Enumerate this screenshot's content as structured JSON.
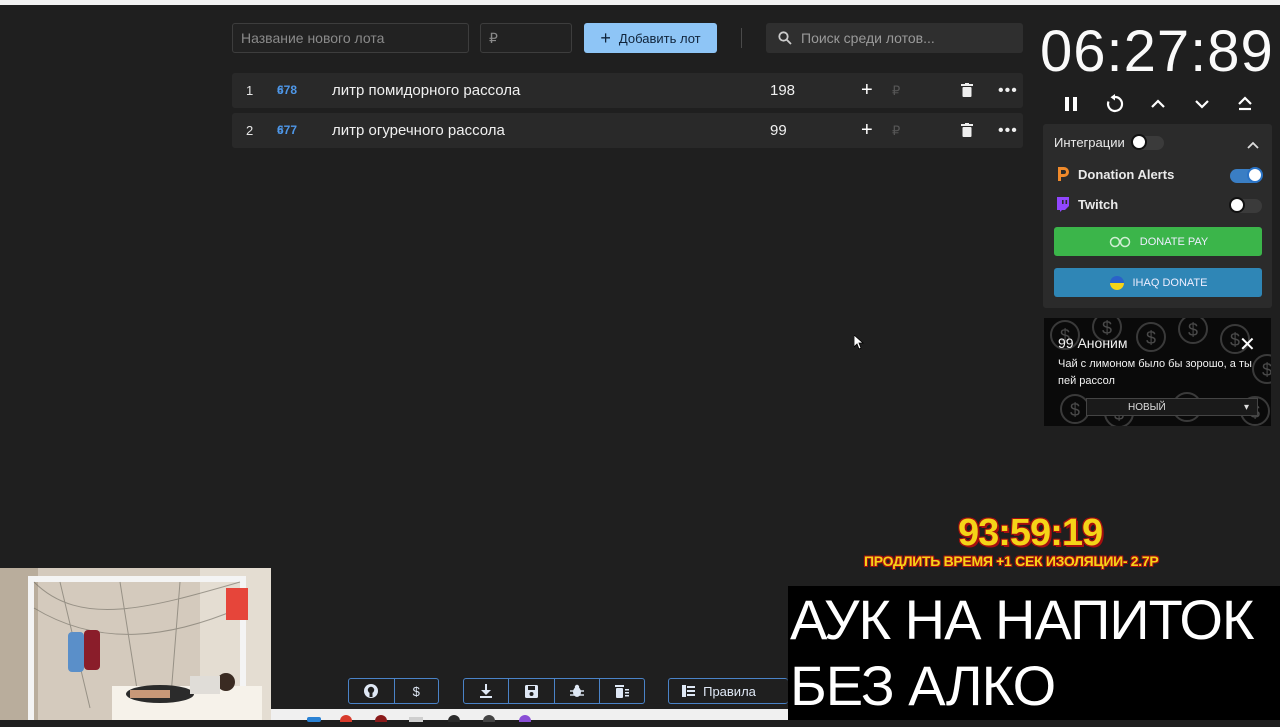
{
  "header": {
    "new_lot_placeholder": "Название нового лота",
    "amount_placeholder": "₽",
    "add_lot_label": "Добавить лот",
    "search_placeholder": "Поиск среди лотов..."
  },
  "lots": [
    {
      "num": "1",
      "id": "678",
      "name": "литр помидорного рассола",
      "amount": "198"
    },
    {
      "num": "2",
      "id": "677",
      "name": "литр огуречного рассола",
      "amount": "99"
    }
  ],
  "timer": {
    "value": "06:27:89"
  },
  "integrations": {
    "title": "Интеграции",
    "master_enabled": false,
    "items": [
      {
        "name": "Donation Alerts",
        "enabled": true
      },
      {
        "name": "Twitch",
        "enabled": false
      }
    ],
    "donate_pay_label": "DONATE PAY",
    "ihaq_label": "IHAQ DONATE"
  },
  "donation": {
    "donor": "99 Аноним",
    "message": "Чай с лимоном было бы зорошо, а ты пей рассол",
    "status": "НОВЫЙ"
  },
  "overlay": {
    "big_timer": "93:59:19",
    "extend_text": "ПРОДЛИТЬ ВРЕМЯ +1 СЕК ИЗОЛЯЦИИ- 2.7Р",
    "banner_line1": "АУК НА НАПИТОК",
    "banner_line2": "БЕЗ АЛКО"
  },
  "toolbar": {
    "github_icon": "github-icon",
    "dollar_label": "$",
    "rules_label": "Правила"
  },
  "colors": {
    "accent": "#8ec5f6",
    "link": "#4e97e8",
    "donate_pay": "#3bb54a",
    "ihaq": "#2f86b6",
    "overlay_yellow": "#f5d418"
  }
}
